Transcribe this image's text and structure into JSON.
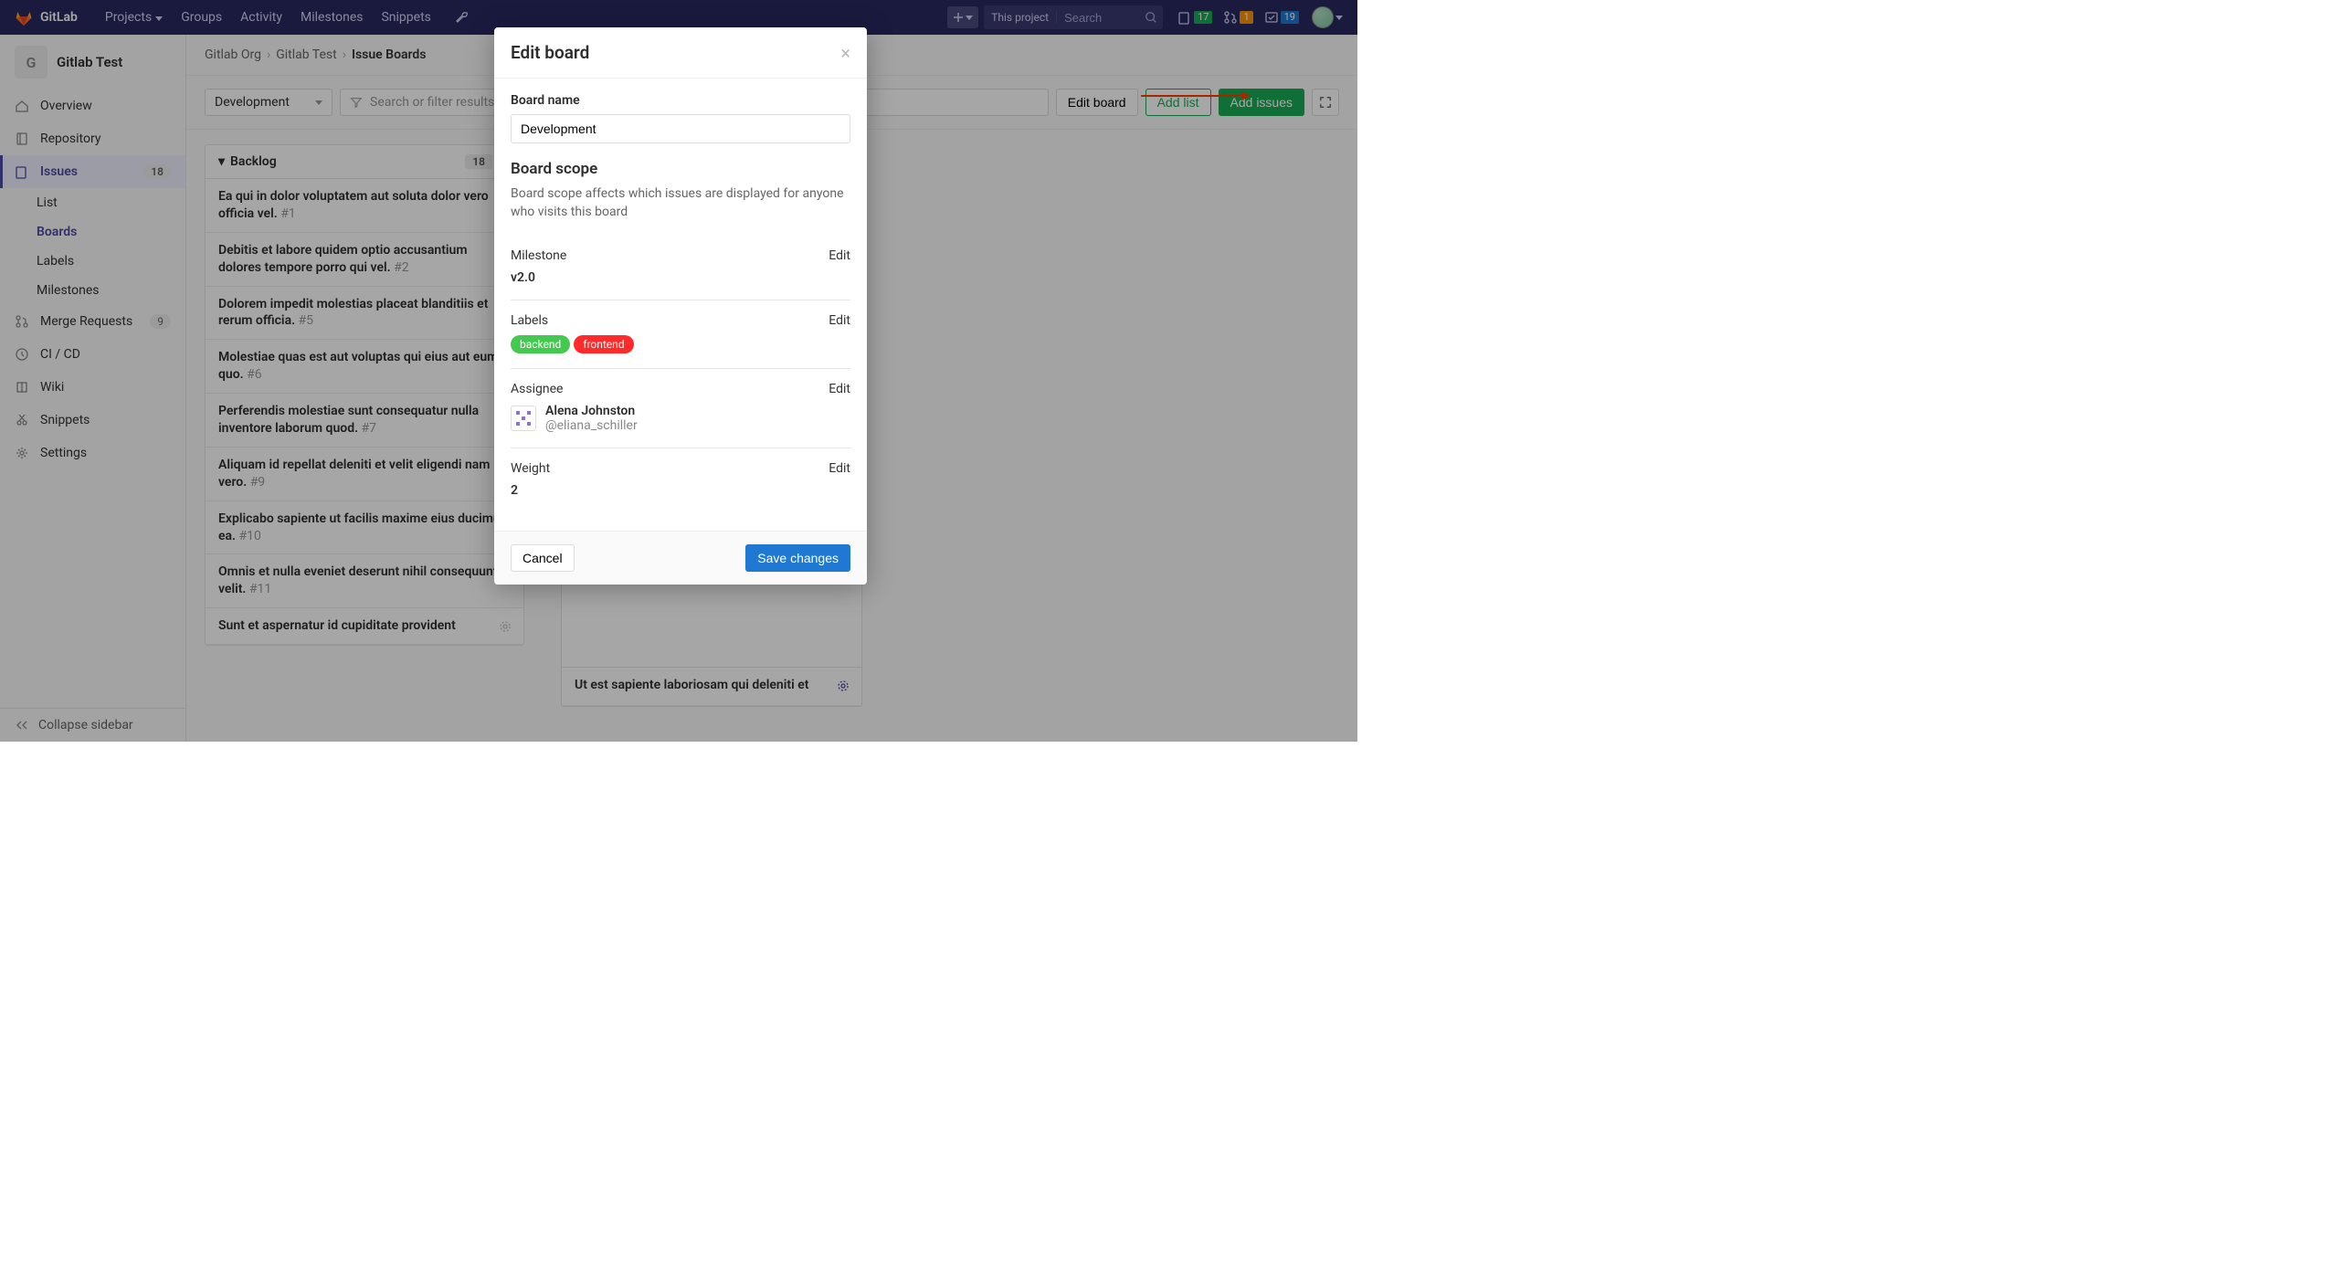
{
  "topnav": {
    "brand": "GitLab",
    "items": [
      "Projects",
      "Groups",
      "Activity",
      "Milestones",
      "Snippets"
    ],
    "search_scope": "This project",
    "search_placeholder": "Search",
    "stat_issues": "17",
    "stat_mrs": "1",
    "stat_todos": "19"
  },
  "project": {
    "initial": "G",
    "name": "Gitlab Test"
  },
  "sidebar": {
    "overview": "Overview",
    "repository": "Repository",
    "issues": "Issues",
    "issues_count": "18",
    "list": "List",
    "boards": "Boards",
    "labels": "Labels",
    "milestones": "Milestones",
    "merge_requests": "Merge Requests",
    "mr_count": "9",
    "cicd": "CI / CD",
    "wiki": "Wiki",
    "snippets": "Snippets",
    "settings": "Settings",
    "collapse": "Collapse sidebar"
  },
  "breadcrumbs": {
    "a": "Gitlab Org",
    "b": "Gitlab Test",
    "c": "Issue Boards"
  },
  "toolbar": {
    "board_selected": "Development",
    "filter_placeholder": "Search or filter results...",
    "edit_board": "Edit board",
    "add_list": "Add list",
    "add_issues": "Add issues"
  },
  "list": {
    "name": "Backlog",
    "count": "18",
    "cards": [
      {
        "title": "Ea qui in dolor voluptatem aut soluta dolor vero officia vel.",
        "id": "#1"
      },
      {
        "title": "Debitis et labore quidem optio accusantium dolores tempore porro qui vel.",
        "id": "#2"
      },
      {
        "title": "Dolorem impedit molestias placeat blanditiis et rerum officia.",
        "id": "#5"
      },
      {
        "title": "Molestiae quas est aut voluptas qui eius aut eum quo.",
        "id": "#6"
      },
      {
        "title": "Perferendis molestiae sunt consequatur nulla inventore laborum quod.",
        "id": "#7"
      },
      {
        "title": "Aliquam id repellat deleniti et velit eligendi nam vero.",
        "id": "#9"
      },
      {
        "title": "Explicabo sapiente ut facilis maxime eius ducimus ea.",
        "id": "#10"
      },
      {
        "title": "Omnis et nulla eveniet deserunt nihil consequuntur velit.",
        "id": "#11"
      },
      {
        "title": "Sunt et aspernatur id cupiditate provident",
        "id": ""
      }
    ],
    "second_visible": "Ut est sapiente laboriosam qui deleniti et"
  },
  "modal": {
    "title": "Edit board",
    "board_name_label": "Board name",
    "board_name_value": "Development",
    "scope_title": "Board scope",
    "scope_desc": "Board scope affects which issues are displayed for anyone who visits this board",
    "edit_link": "Edit",
    "milestone_label": "Milestone",
    "milestone_value": "v2.0",
    "labels_label": "Labels",
    "label_chips": [
      {
        "text": "backend",
        "color": "#44c950"
      },
      {
        "text": "frontend",
        "color": "#ff2a2a"
      }
    ],
    "assignee_label": "Assignee",
    "assignee_name": "Alena Johnston",
    "assignee_handle": "@eliana_schiller",
    "weight_label": "Weight",
    "weight_value": "2",
    "cancel": "Cancel",
    "save": "Save changes"
  }
}
